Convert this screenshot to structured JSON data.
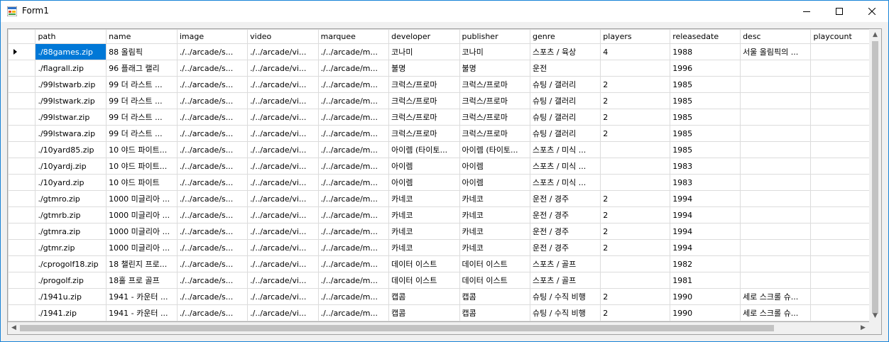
{
  "window": {
    "title": "Form1"
  },
  "grid": {
    "columns": [
      "path",
      "name",
      "image",
      "video",
      "marquee",
      "developer",
      "publisher",
      "genre",
      "players",
      "releasedate",
      "desc",
      "playcount"
    ],
    "rows": [
      [
        "./88games.zip",
        "88 올림픽",
        "./../arcade/s...",
        "./../arcade/vi...",
        "./../arcade/m...",
        "코나미",
        "코나미",
        "스포츠 / 육상",
        "4",
        "1988",
        "서울 올림픽의 ...",
        ""
      ],
      [
        "./flagrall.zip",
        "96 플래그 랠리",
        "./../arcade/s...",
        "./../arcade/vi...",
        "./../arcade/m...",
        "불명",
        "불명",
        "운전",
        "",
        "1996",
        "",
        ""
      ],
      [
        "./99lstwarb.zip",
        "99 더 라스트 ...",
        "./../arcade/s...",
        "./../arcade/vi...",
        "./../arcade/m...",
        "크럭스/프로마",
        "크럭스/프로마",
        "슈팅 / 갤러리",
        "2",
        "1985",
        "",
        ""
      ],
      [
        "./99lstwark.zip",
        "99 더 라스트 ...",
        "./../arcade/s...",
        "./../arcade/vi...",
        "./../arcade/m...",
        "크럭스/프로마",
        "크럭스/프로마",
        "슈팅 / 갤러리",
        "2",
        "1985",
        "",
        ""
      ],
      [
        "./99lstwar.zip",
        "99 더 라스트 ...",
        "./../arcade/s...",
        "./../arcade/vi...",
        "./../arcade/m...",
        "크럭스/프로마",
        "크럭스/프로마",
        "슈팅 / 갤러리",
        "2",
        "1985",
        "",
        ""
      ],
      [
        "./99lstwara.zip",
        "99 더 라스트 ...",
        "./../arcade/s...",
        "./../arcade/vi...",
        "./../arcade/m...",
        "크럭스/프로마",
        "크럭스/프로마",
        "슈팅 / 갤러리",
        "2",
        "1985",
        "",
        ""
      ],
      [
        "./10yard85.zip",
        "10 야드 파이트...",
        "./../arcade/s...",
        "./../arcade/vi...",
        "./../arcade/m...",
        "아이렘 (타이토...",
        "아이렘 (타이토...",
        "스포츠 / 미식 ...",
        "",
        "1985",
        "",
        ""
      ],
      [
        "./10yardj.zip",
        "10 야드 파이트...",
        "./../arcade/s...",
        "./../arcade/vi...",
        "./../arcade/m...",
        "아이렘",
        "아이렘",
        "스포츠 / 미식 ...",
        "",
        "1983",
        "",
        ""
      ],
      [
        "./10yard.zip",
        "10 야드 파이트",
        "./../arcade/s...",
        "./../arcade/vi...",
        "./../arcade/m...",
        "아이렘",
        "아이렘",
        "스포츠 / 미식 ...",
        "",
        "1983",
        "",
        ""
      ],
      [
        "./gtmro.zip",
        "1000 미글리아 ...",
        "./../arcade/s...",
        "./../arcade/vi...",
        "./../arcade/m...",
        "카네코",
        "카네코",
        "운전 / 경주",
        "2",
        "1994",
        "",
        ""
      ],
      [
        "./gtmrb.zip",
        "1000 미글리아 ...",
        "./../arcade/s...",
        "./../arcade/vi...",
        "./../arcade/m...",
        "카네코",
        "카네코",
        "운전 / 경주",
        "2",
        "1994",
        "",
        ""
      ],
      [
        "./gtmra.zip",
        "1000 미글리아 ...",
        "./../arcade/s...",
        "./../arcade/vi...",
        "./../arcade/m...",
        "카네코",
        "카네코",
        "운전 / 경주",
        "2",
        "1994",
        "",
        ""
      ],
      [
        "./gtmr.zip",
        "1000 미글리아 ...",
        "./../arcade/s...",
        "./../arcade/vi...",
        "./../arcade/m...",
        "카네코",
        "카네코",
        "운전 / 경주",
        "2",
        "1994",
        "",
        ""
      ],
      [
        "./cprogolf18.zip",
        "18 챌린지 프로...",
        "./../arcade/s...",
        "./../arcade/vi...",
        "./../arcade/m...",
        "데이터 이스트",
        "데이터 이스트",
        "스포츠 / 골프",
        "",
        "1982",
        "",
        ""
      ],
      [
        "./progolf.zip",
        "18홀 프로 골프",
        "./../arcade/s...",
        "./../arcade/vi...",
        "./../arcade/m...",
        "데이터 이스트",
        "데이터 이스트",
        "스포츠 / 골프",
        "",
        "1981",
        "",
        ""
      ],
      [
        "./1941u.zip",
        "1941 - 카운터 ...",
        "./../arcade/s...",
        "./../arcade/vi...",
        "./../arcade/m...",
        "캡콤",
        "캡콤",
        "슈팅 / 수직 비행",
        "2",
        "1990",
        "세로 스크롤 슈...",
        ""
      ],
      [
        "./1941.zip",
        "1941 - 카운터 ...",
        "./../arcade/s...",
        "./../arcade/vi...",
        "./../arcade/m...",
        "캡콤",
        "캡콤",
        "슈팅 / 수직 비행",
        "2",
        "1990",
        "세로 스크롤 슈...",
        ""
      ]
    ],
    "selected_row": 0,
    "selected_col": 0
  },
  "icons": {
    "app": "winforms-app-icon",
    "minimize": "minimize-icon",
    "maximize": "maximize-icon",
    "close": "close-icon"
  },
  "colors": {
    "selection": "#0078d7",
    "border": "#1883d7"
  }
}
